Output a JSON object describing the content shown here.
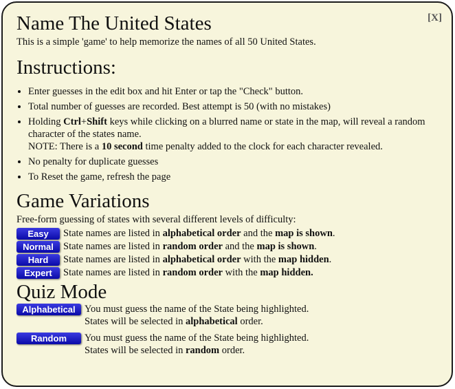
{
  "header": {
    "title": "Name The United States",
    "subtitle": "This is a simple 'game' to help memorize the names of all 50 United States.",
    "close_label": "[X]"
  },
  "instructions": {
    "heading": "Instructions:",
    "items": [
      [
        "Enter guesses in the edit box and hit Enter or tap the \"Check\" button."
      ],
      [
        "Total number of guesses are recorded. Best attempt is 50 (with no mistakes)"
      ],
      [
        "Holding ",
        "Ctrl",
        "+",
        "Shift",
        " keys while clicking on a blurred name or state in the map, will reveal a random character of the states name.",
        "NOTE: There is a ",
        "10 second",
        " time penalty added to the clock for each character revealed."
      ],
      [
        "No penalty for duplicate guesses"
      ],
      [
        "To Reset the game, refresh the page"
      ]
    ]
  },
  "variations": {
    "heading": "Game Variations",
    "intro": "Free-form guessing of states with several different levels of difficulty:",
    "levels": [
      {
        "label": "Easy",
        "text": [
          "State names are listed in ",
          "alphabetical order",
          " and the ",
          "map is shown",
          "."
        ]
      },
      {
        "label": "Normal",
        "text": [
          "State names are listed in ",
          "random order",
          " and the ",
          "map is shown",
          "."
        ]
      },
      {
        "label": "Hard",
        "text": [
          "State names are listed in ",
          "alphabetical order",
          " with the ",
          "map hidden",
          "."
        ]
      },
      {
        "label": "Expert",
        "text": [
          "State names are listed in ",
          "random order",
          " with the ",
          "map hidden.",
          ""
        ]
      }
    ]
  },
  "quiz": {
    "heading": "Quiz Mode",
    "modes": [
      {
        "label": "Alphabetical",
        "line1": "You must guess the name of the State being highlighted.",
        "line2": [
          "States will be selected in ",
          "alphabetical",
          " order."
        ]
      },
      {
        "label": "Random",
        "line1": "You must guess the name of the State being highlighted.",
        "line2": [
          "States will be selected in ",
          "random",
          " order."
        ]
      }
    ]
  },
  "colors": {
    "panel_background": "#f7f5dc",
    "button_blue": "#0a0aa8",
    "border": "#1a1a1a"
  }
}
